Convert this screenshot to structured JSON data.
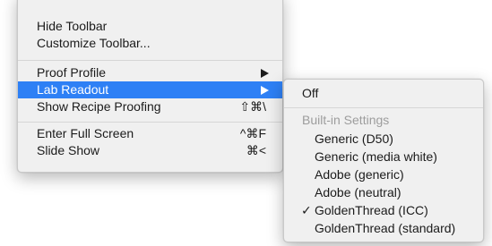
{
  "main_menu": {
    "items": [
      {
        "label": "Hide Toolbar"
      },
      {
        "label": "Customize Toolbar..."
      },
      {
        "label": "Proof Profile"
      },
      {
        "label": "Lab Readout"
      },
      {
        "label": "Show Recipe Proofing",
        "shortcut": "⇧⌘\\"
      },
      {
        "label": "Enter Full Screen",
        "shortcut": "^⌘F"
      },
      {
        "label": "Slide Show",
        "shortcut": "⌘<"
      }
    ]
  },
  "submenu": {
    "off_label": "Off",
    "section_header": "Built-in Settings",
    "checkmark": "✓",
    "items": [
      {
        "label": "Generic (D50)"
      },
      {
        "label": "Generic (media white)"
      },
      {
        "label": "Adobe (generic)"
      },
      {
        "label": "Adobe (neutral)"
      },
      {
        "label": "GoldenThread (ICC)",
        "checked": true
      },
      {
        "label": "GoldenThread (standard)"
      }
    ]
  },
  "colors": {
    "highlight": "#2e80f5",
    "menu_background": "#f0f0f0",
    "disabled_text": "#9d9d9d"
  },
  "icons": {
    "submenu_arrow": "triangle-right-icon",
    "checkmark": "checkmark-icon"
  }
}
